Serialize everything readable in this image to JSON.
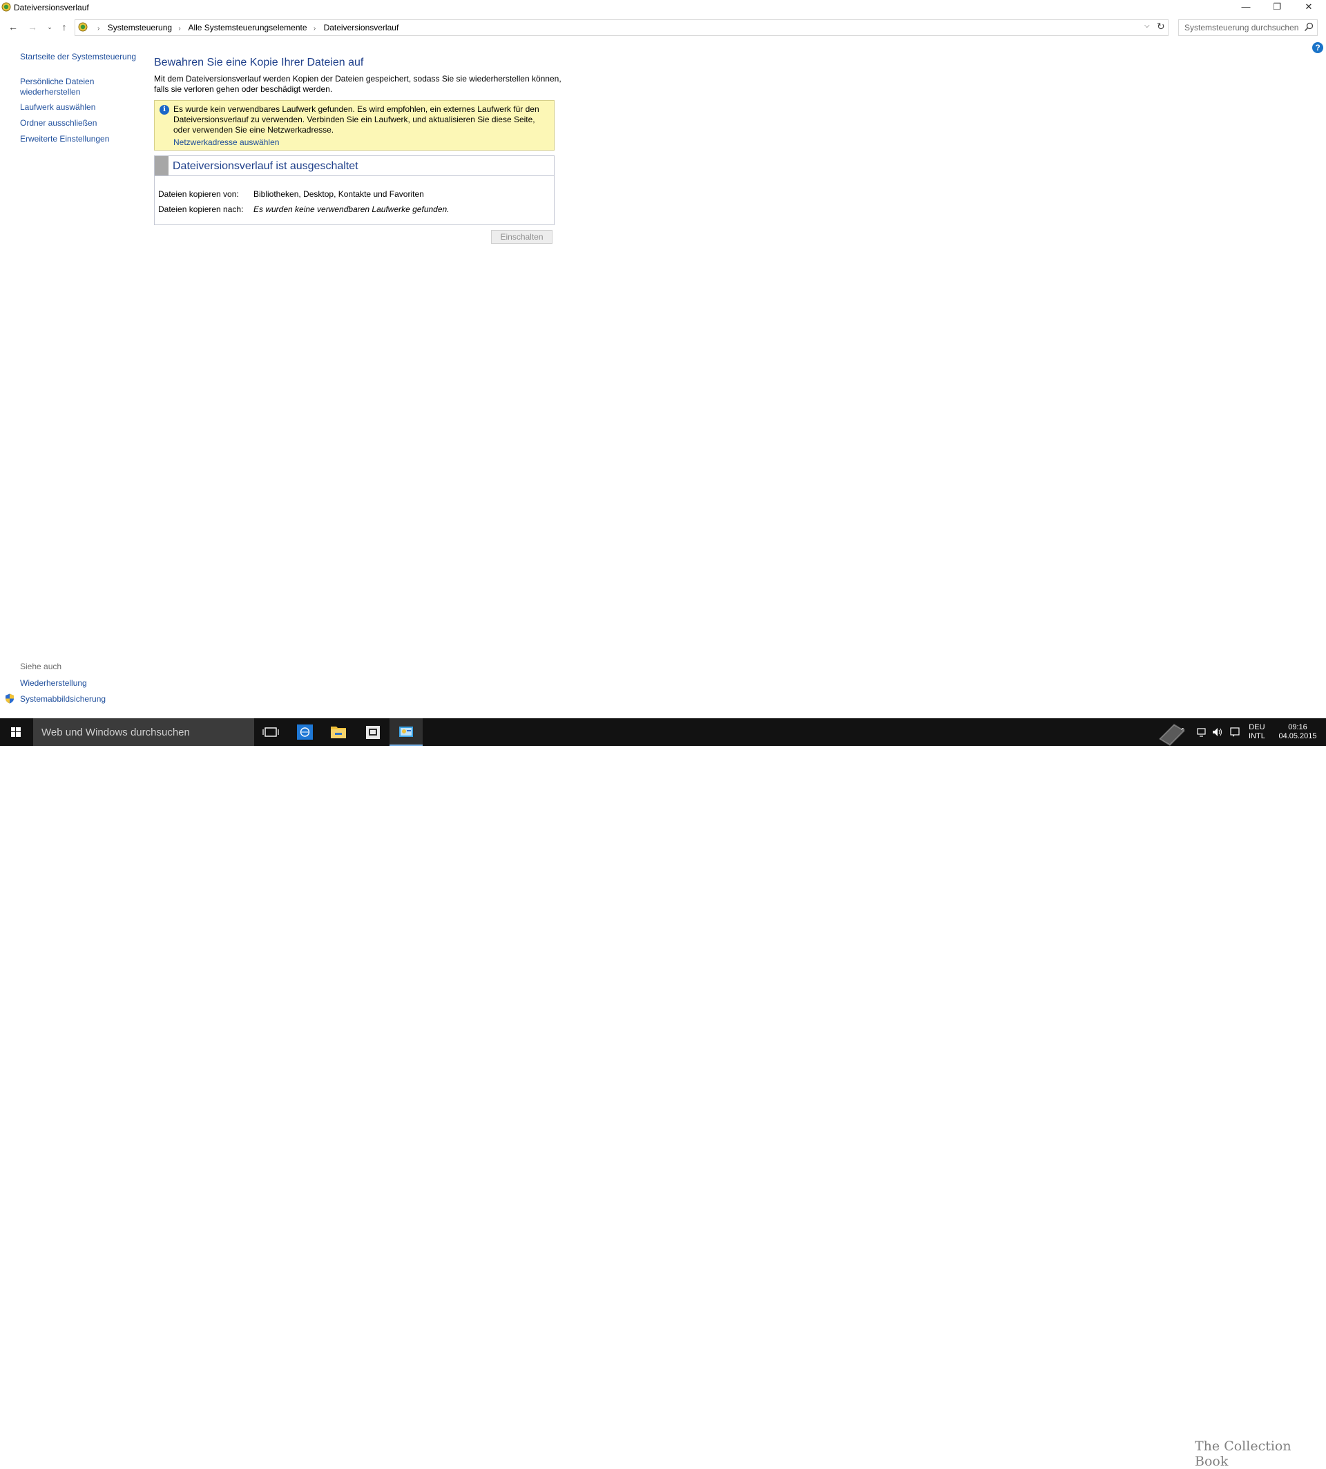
{
  "window": {
    "title": "Dateiversionsverlauf",
    "minimize_glyph": "—",
    "maximize_glyph": "❐",
    "close_glyph": "✕"
  },
  "address_bar": {
    "crumbs": [
      "Systemsteuerung",
      "Alle Systemsteuerungselemente",
      "Dateiversionsverlauf"
    ],
    "search_placeholder": "Systemsteuerung durchsuchen"
  },
  "sidebar": {
    "home": "Startseite der Systemsteuerung",
    "items": [
      {
        "label": "Persönliche Dateien wiederherstellen"
      },
      {
        "label": "Laufwerk auswählen"
      },
      {
        "label": "Ordner ausschließen"
      },
      {
        "label": "Erweiterte Einstellungen"
      }
    ],
    "see_also": {
      "heading": "Siehe auch",
      "items": [
        {
          "label": "Wiederherstellung"
        },
        {
          "label": "Systemabbildsicherung"
        }
      ]
    }
  },
  "main": {
    "heading": "Bewahren Sie eine Kopie Ihrer Dateien auf",
    "description": "Mit dem Dateiversionsverlauf werden Kopien der Dateien gespeichert, sodass Sie sie wiederherstellen können, falls sie verloren gehen oder beschädigt werden.",
    "warning": {
      "message": "Es wurde kein verwendbares Laufwerk gefunden. Es wird empfohlen, ein externes Laufwerk für den Dateiversionsverlauf zu verwenden. Verbinden Sie ein Laufwerk, und aktualisieren Sie diese Seite, oder verwenden Sie eine Netzwerkadresse.",
      "link": "Netzwerkadresse auswählen"
    },
    "status": {
      "title": "Dateiversionsverlauf ist ausgeschaltet",
      "rows": [
        {
          "label": "Dateien kopieren von:",
          "value": "Bibliotheken, Desktop, Kontakte und Favoriten"
        },
        {
          "label": "Dateien kopieren nach:",
          "value": "Es wurden keine verwendbaren Laufwerke gefunden."
        }
      ]
    },
    "turn_on_button": "Einschalten"
  },
  "taskbar": {
    "search_placeholder": "Web und Windows durchsuchen",
    "language": "DEU",
    "keyboard": "INTL",
    "time": "09:16",
    "date": "04.05.2015",
    "watermark": "The Collection Book"
  },
  "colors": {
    "link": "#1e4e9c",
    "heading": "#1e3f8a",
    "warning_bg": "#fcf7b6",
    "taskbar": "#121212"
  }
}
